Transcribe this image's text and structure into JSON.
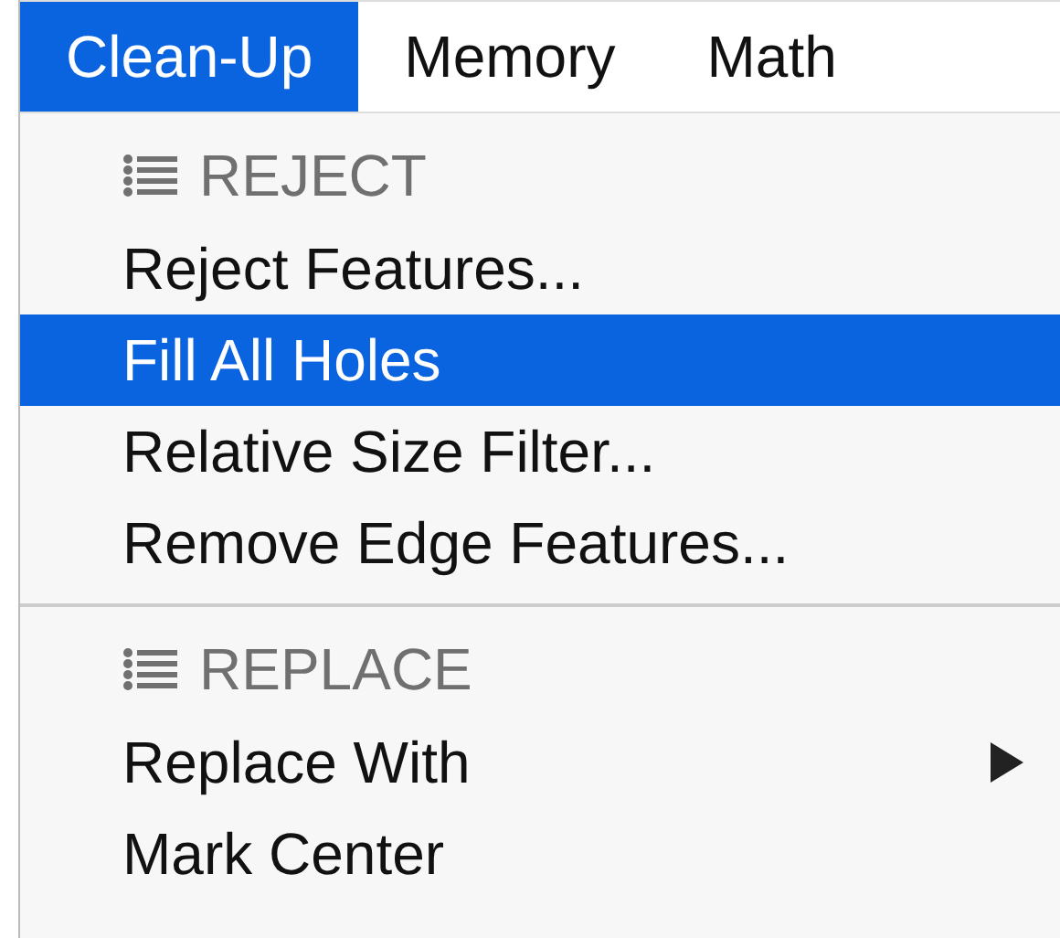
{
  "menubar": [
    {
      "label": "Clean-Up",
      "selected": true
    },
    {
      "label": "Memory",
      "selected": false
    },
    {
      "label": "Math",
      "selected": false
    }
  ],
  "menu": {
    "sections": [
      {
        "header": "REJECT",
        "items": [
          {
            "label": "Reject Features...",
            "selected": false,
            "submenu": false
          },
          {
            "label": "Fill All Holes",
            "selected": true,
            "submenu": false
          },
          {
            "label": "Relative Size Filter...",
            "selected": false,
            "submenu": false
          },
          {
            "label": "Remove Edge Features...",
            "selected": false,
            "submenu": false
          }
        ]
      },
      {
        "header": "REPLACE",
        "items": [
          {
            "label": "Replace With",
            "selected": false,
            "submenu": true
          },
          {
            "label": "Mark Center",
            "selected": false,
            "submenu": false
          }
        ]
      }
    ]
  }
}
